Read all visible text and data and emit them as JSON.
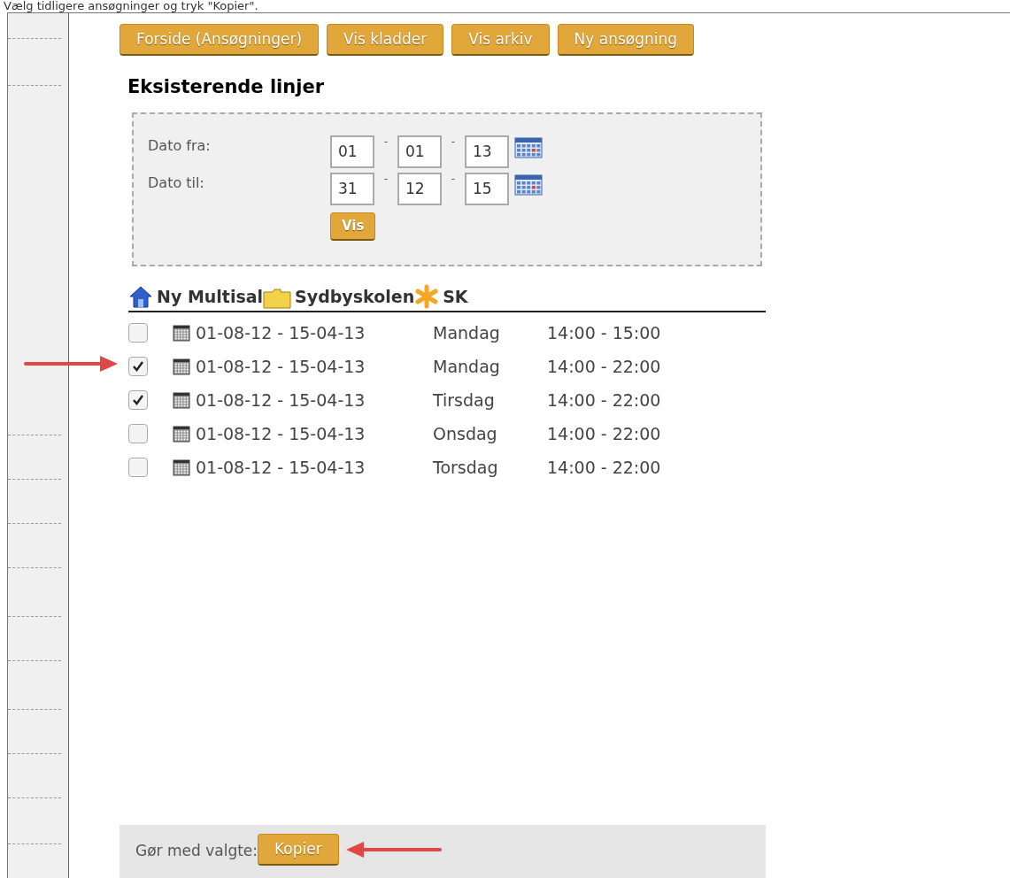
{
  "instruction": "Vælg tidligere ansøgninger og tryk \"Kopier\".",
  "nav_buttons": [
    "Forside (Ansøgninger)",
    "Vis kladder",
    "Vis arkiv",
    "Ny ansøgning"
  ],
  "heading": "Eksisterende linjer",
  "filter": {
    "rows": [
      {
        "label": "Dato fra:",
        "day": "01",
        "month": "01",
        "year": "13"
      },
      {
        "label": "Dato til:",
        "day": "31",
        "month": "12",
        "year": "15"
      }
    ],
    "separator": "-",
    "button": "Vis"
  },
  "breadcrumb": [
    "Ny Multisal",
    "Sydbyskolen",
    "SK"
  ],
  "lines": [
    {
      "period": "01-08-12 - 15-04-13",
      "day": "Mandag",
      "time": "14:00 - 15:00",
      "checked": false,
      "arrow": false
    },
    {
      "period": "01-08-12 - 15-04-13",
      "day": "Mandag",
      "time": "14:00 - 22:00",
      "checked": true,
      "arrow": true
    },
    {
      "period": "01-08-12 - 15-04-13",
      "day": "Tirsdag",
      "time": "14:00 - 22:00",
      "checked": true,
      "arrow": false
    },
    {
      "period": "01-08-12 - 15-04-13",
      "day": "Onsdag",
      "time": "14:00 - 22:00",
      "checked": false,
      "arrow": false
    },
    {
      "period": "01-08-12 - 15-04-13",
      "day": "Torsdag",
      "time": "14:00 - 22:00",
      "checked": false,
      "arrow": false
    }
  ],
  "actions": {
    "label": "Gør med valgte:",
    "button": "Kopier"
  }
}
